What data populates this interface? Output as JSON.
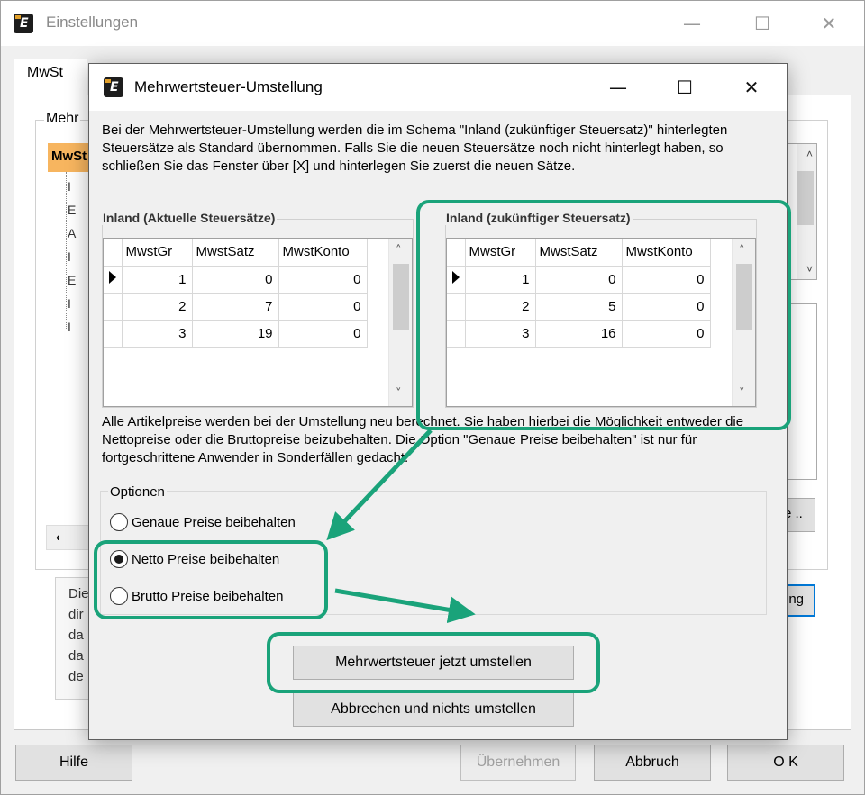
{
  "parent_window": {
    "title": "Einstellungen",
    "tab_label": "MwSt",
    "group_label": "Mehr",
    "tree_selected": "MwSt",
    "tree_items": [
      "I",
      "E",
      "A",
      "I",
      "E",
      "I",
      "I"
    ],
    "right_button_label": "e ..",
    "right_button2_label": "ung",
    "hscroll_left": "‹",
    "desc_lines": [
      "Die",
      "dir",
      "da",
      "da",
      "de"
    ],
    "buttons": {
      "help": "Hilfe",
      "apply": "Übernehmen",
      "cancel": "Abbruch",
      "ok": "O K"
    }
  },
  "dialog": {
    "title": "Mehrwertsteuer-Umstellung",
    "intro_text": "Bei der Mehrwertsteuer-Umstellung werden die im Schema \"Inland (zukünftiger Steuersatz)\" hinterlegten Steuersätze als Standard übernommen. Falls Sie die neuen Steuersätze noch nicht hinterlegt haben, so schließen Sie das Fenster über [X] und hinterlegen Sie zuerst die neuen Sätze.",
    "info_text": "Alle Artikelpreise werden bei der Umstellung neu berechnet. Sie haben hierbei die Möglichkeit entweder die Nettopreise oder die Bruttopreise beizubehalten. Die Option \"Genaue Preise beibehalten\" ist nur für fortgeschrittene Anwender in Sonderfällen gedacht.",
    "current_table": {
      "caption": "Inland (Aktuelle Steuersätze)",
      "columns": [
        "MwstGr",
        "MwstSatz",
        "MwstKonto"
      ],
      "rows": [
        [
          "1",
          "0",
          "0"
        ],
        [
          "2",
          "7",
          "0"
        ],
        [
          "3",
          "19",
          "0"
        ]
      ]
    },
    "future_table": {
      "caption": "Inland (zukünftiger Steuersatz)",
      "columns": [
        "MwstGr",
        "MwstSatz",
        "MwstKonto"
      ],
      "rows": [
        [
          "1",
          "0",
          "0"
        ],
        [
          "2",
          "5",
          "0"
        ],
        [
          "3",
          "16",
          "0"
        ]
      ]
    },
    "options": {
      "caption": "Optionen",
      "items": [
        {
          "label": "Genaue Preise beibehalten",
          "checked": false
        },
        {
          "label": "Netto Preise beibehalten",
          "checked": true
        },
        {
          "label": "Brutto Preise beibehalten",
          "checked": false
        }
      ]
    },
    "buttons": {
      "convert": "Mehrwertsteuer jetzt umstellen",
      "abort": "Abbrechen und nichts umstellen"
    }
  },
  "annotation": {
    "highlight_color": "#1aa37a"
  }
}
